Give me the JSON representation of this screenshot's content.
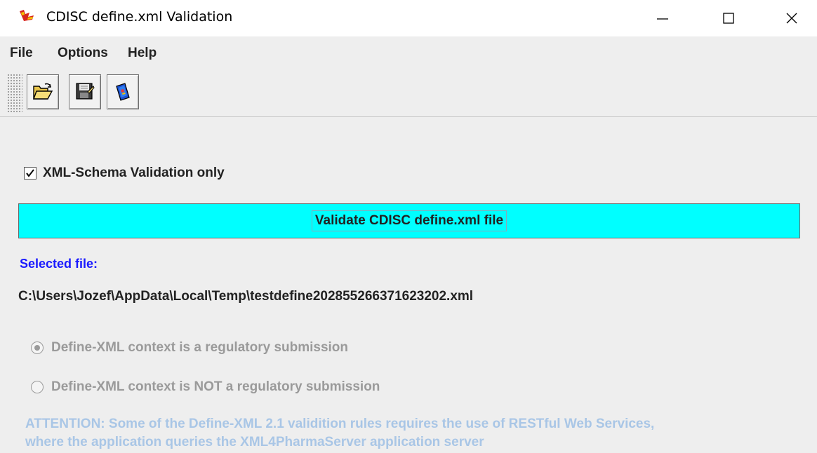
{
  "window": {
    "title": "CDISC define.xml Validation",
    "minimize_glyph": "—",
    "maximize_glyph": "☐",
    "close_glyph": "✕"
  },
  "menu": [
    "File",
    "Options",
    "Help"
  ],
  "toolbar": {
    "buttons": [
      {
        "icon": "open-folder-icon"
      },
      {
        "icon": "save-disk-icon"
      },
      {
        "icon": "validate-book-icon"
      }
    ]
  },
  "options": {
    "schema_only_label": "XML-Schema Validation only",
    "schema_only_checked": true
  },
  "validate_button_label": "Validate CDISC define.xml file",
  "selected_file": {
    "label": "Selected file:",
    "path": "C:\\Users\\Jozef\\AppData\\Local\\Temp\\testdefine202855266371623202.xml"
  },
  "context": {
    "regulatory_label": "Define-XML context is a regulatory submission",
    "regulatory_selected": true,
    "non_regulatory_label": "Define-XML context is NOT a regulatory submission",
    "non_regulatory_selected": false
  },
  "attention_text": {
    "line1": "ATTENTION: Some of the Define-XML 2.1 validition rules requires the use of RESTful Web Services,",
    "line2": "where the application queries the XML4PharmaServer application server"
  },
  "colors": {
    "validate_button_bg": "#00ffff",
    "selected_label": "#1a1aff",
    "disabled_text": "#9a9a9a",
    "attention_text": "#a9c6e6"
  }
}
